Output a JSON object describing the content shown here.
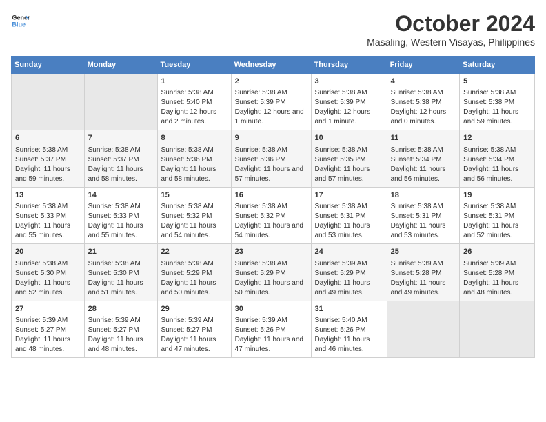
{
  "logo": {
    "line1": "General",
    "line2": "Blue"
  },
  "title": "October 2024",
  "subtitle": "Masaling, Western Visayas, Philippines",
  "days_of_week": [
    "Sunday",
    "Monday",
    "Tuesday",
    "Wednesday",
    "Thursday",
    "Friday",
    "Saturday"
  ],
  "weeks": [
    [
      {
        "day": "",
        "empty": true
      },
      {
        "day": "",
        "empty": true
      },
      {
        "day": "1",
        "sunrise": "5:38 AM",
        "sunset": "5:40 PM",
        "daylight": "12 hours and 2 minutes."
      },
      {
        "day": "2",
        "sunrise": "5:38 AM",
        "sunset": "5:39 PM",
        "daylight": "12 hours and 1 minute."
      },
      {
        "day": "3",
        "sunrise": "5:38 AM",
        "sunset": "5:39 PM",
        "daylight": "12 hours and 1 minute."
      },
      {
        "day": "4",
        "sunrise": "5:38 AM",
        "sunset": "5:38 PM",
        "daylight": "12 hours and 0 minutes."
      },
      {
        "day": "5",
        "sunrise": "5:38 AM",
        "sunset": "5:38 PM",
        "daylight": "11 hours and 59 minutes."
      }
    ],
    [
      {
        "day": "6",
        "sunrise": "5:38 AM",
        "sunset": "5:37 PM",
        "daylight": "11 hours and 59 minutes."
      },
      {
        "day": "7",
        "sunrise": "5:38 AM",
        "sunset": "5:37 PM",
        "daylight": "11 hours and 58 minutes."
      },
      {
        "day": "8",
        "sunrise": "5:38 AM",
        "sunset": "5:36 PM",
        "daylight": "11 hours and 58 minutes."
      },
      {
        "day": "9",
        "sunrise": "5:38 AM",
        "sunset": "5:36 PM",
        "daylight": "11 hours and 57 minutes."
      },
      {
        "day": "10",
        "sunrise": "5:38 AM",
        "sunset": "5:35 PM",
        "daylight": "11 hours and 57 minutes."
      },
      {
        "day": "11",
        "sunrise": "5:38 AM",
        "sunset": "5:34 PM",
        "daylight": "11 hours and 56 minutes."
      },
      {
        "day": "12",
        "sunrise": "5:38 AM",
        "sunset": "5:34 PM",
        "daylight": "11 hours and 56 minutes."
      }
    ],
    [
      {
        "day": "13",
        "sunrise": "5:38 AM",
        "sunset": "5:33 PM",
        "daylight": "11 hours and 55 minutes."
      },
      {
        "day": "14",
        "sunrise": "5:38 AM",
        "sunset": "5:33 PM",
        "daylight": "11 hours and 55 minutes."
      },
      {
        "day": "15",
        "sunrise": "5:38 AM",
        "sunset": "5:32 PM",
        "daylight": "11 hours and 54 minutes."
      },
      {
        "day": "16",
        "sunrise": "5:38 AM",
        "sunset": "5:32 PM",
        "daylight": "11 hours and 54 minutes."
      },
      {
        "day": "17",
        "sunrise": "5:38 AM",
        "sunset": "5:31 PM",
        "daylight": "11 hours and 53 minutes."
      },
      {
        "day": "18",
        "sunrise": "5:38 AM",
        "sunset": "5:31 PM",
        "daylight": "11 hours and 53 minutes."
      },
      {
        "day": "19",
        "sunrise": "5:38 AM",
        "sunset": "5:31 PM",
        "daylight": "11 hours and 52 minutes."
      }
    ],
    [
      {
        "day": "20",
        "sunrise": "5:38 AM",
        "sunset": "5:30 PM",
        "daylight": "11 hours and 52 minutes."
      },
      {
        "day": "21",
        "sunrise": "5:38 AM",
        "sunset": "5:30 PM",
        "daylight": "11 hours and 51 minutes."
      },
      {
        "day": "22",
        "sunrise": "5:38 AM",
        "sunset": "5:29 PM",
        "daylight": "11 hours and 50 minutes."
      },
      {
        "day": "23",
        "sunrise": "5:38 AM",
        "sunset": "5:29 PM",
        "daylight": "11 hours and 50 minutes."
      },
      {
        "day": "24",
        "sunrise": "5:39 AM",
        "sunset": "5:29 PM",
        "daylight": "11 hours and 49 minutes."
      },
      {
        "day": "25",
        "sunrise": "5:39 AM",
        "sunset": "5:28 PM",
        "daylight": "11 hours and 49 minutes."
      },
      {
        "day": "26",
        "sunrise": "5:39 AM",
        "sunset": "5:28 PM",
        "daylight": "11 hours and 48 minutes."
      }
    ],
    [
      {
        "day": "27",
        "sunrise": "5:39 AM",
        "sunset": "5:27 PM",
        "daylight": "11 hours and 48 minutes."
      },
      {
        "day": "28",
        "sunrise": "5:39 AM",
        "sunset": "5:27 PM",
        "daylight": "11 hours and 48 minutes."
      },
      {
        "day": "29",
        "sunrise": "5:39 AM",
        "sunset": "5:27 PM",
        "daylight": "11 hours and 47 minutes."
      },
      {
        "day": "30",
        "sunrise": "5:39 AM",
        "sunset": "5:26 PM",
        "daylight": "11 hours and 47 minutes."
      },
      {
        "day": "31",
        "sunrise": "5:40 AM",
        "sunset": "5:26 PM",
        "daylight": "11 hours and 46 minutes."
      },
      {
        "day": "",
        "empty": true
      },
      {
        "day": "",
        "empty": true
      }
    ]
  ]
}
